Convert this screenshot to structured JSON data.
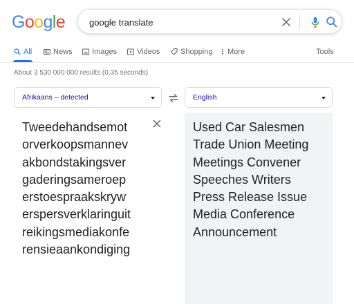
{
  "logo": {
    "letters": [
      {
        "ch": "G",
        "color": "#4285F4"
      },
      {
        "ch": "o",
        "color": "#EA4335"
      },
      {
        "ch": "o",
        "color": "#FBBC05"
      },
      {
        "ch": "g",
        "color": "#4285F4"
      },
      {
        "ch": "l",
        "color": "#34A853"
      },
      {
        "ch": "e",
        "color": "#EA4335"
      }
    ]
  },
  "search": {
    "query": "google translate",
    "icons": [
      "clear-icon",
      "microphone-icon",
      "search-icon"
    ]
  },
  "tabs": {
    "all": "All",
    "news": "News",
    "images": "Images",
    "videos": "Videos",
    "shopping": "Shopping",
    "more": "More",
    "tools": "Tools"
  },
  "stats": "About 3 530 000 000 results (0,35 seconds)",
  "translate": {
    "source_lang": "Afrikaans – detected",
    "target_lang": "English",
    "source_text": "Tweedehandsemotorverkoopsmannevakbondstakingsvergaderingsameroeperstoespraakskrywerspersverklaringuitreikingsmediakonferensieaankondiging",
    "target_lines": [
      "Used Car Salesmen",
      "Trade Union Meeting",
      "Meetings Convener",
      "Speeches Writers",
      "Press Release Issue",
      "Media Conference",
      "Announcement"
    ]
  },
  "colors": {
    "accent": "#1a73e8",
    "link": "#1a0dab",
    "muted": "#70757a",
    "panel": "#f1f3f4"
  }
}
